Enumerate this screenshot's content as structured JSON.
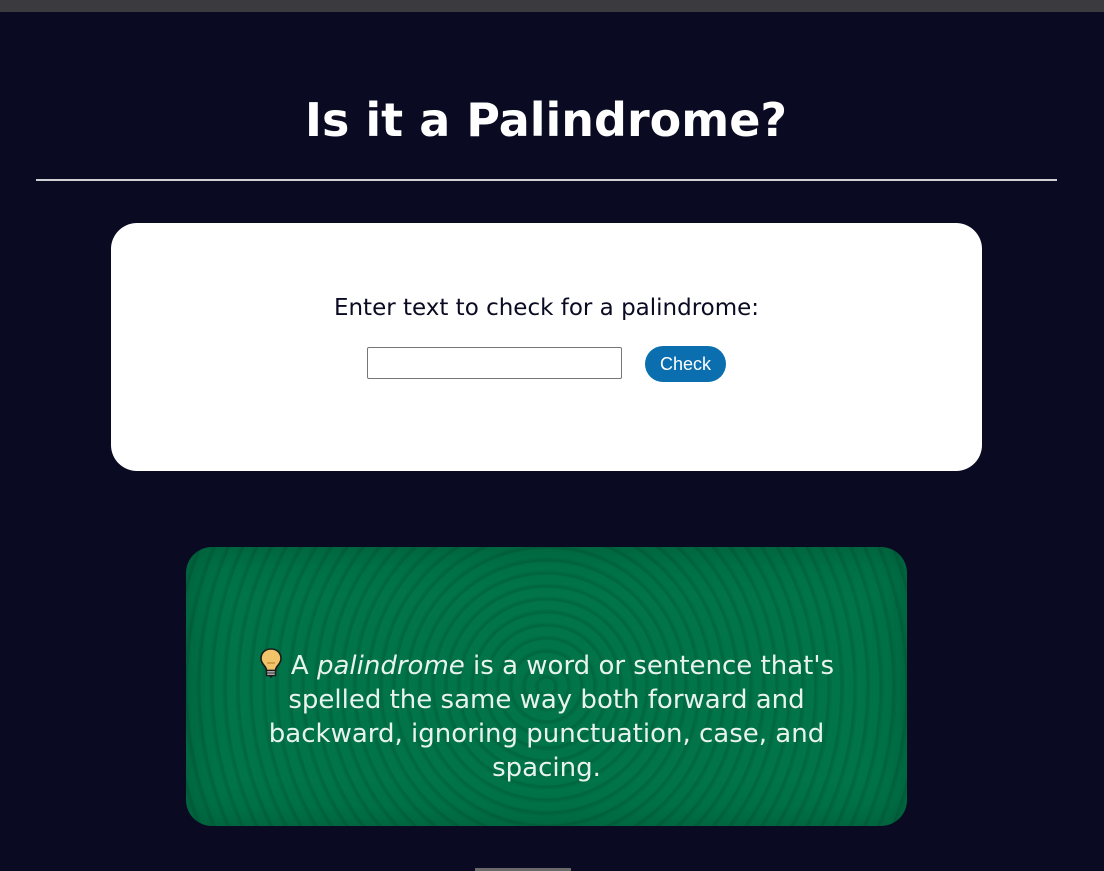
{
  "page": {
    "title": "Is it a Palindrome?"
  },
  "checker": {
    "prompt": "Enter text to check for a palindrome:",
    "input_value": "",
    "input_placeholder": "",
    "button_label": "Check"
  },
  "info": {
    "icon": "lightbulb-icon",
    "before": "A ",
    "term": "palindrome",
    "after": " is a word or sentence that's spelled the same way both forward and backward, ignoring punctuation, case, and spacing."
  },
  "colors": {
    "background": "#0a0a23",
    "button": "#0b6faf",
    "info_panel": "#00663f"
  }
}
